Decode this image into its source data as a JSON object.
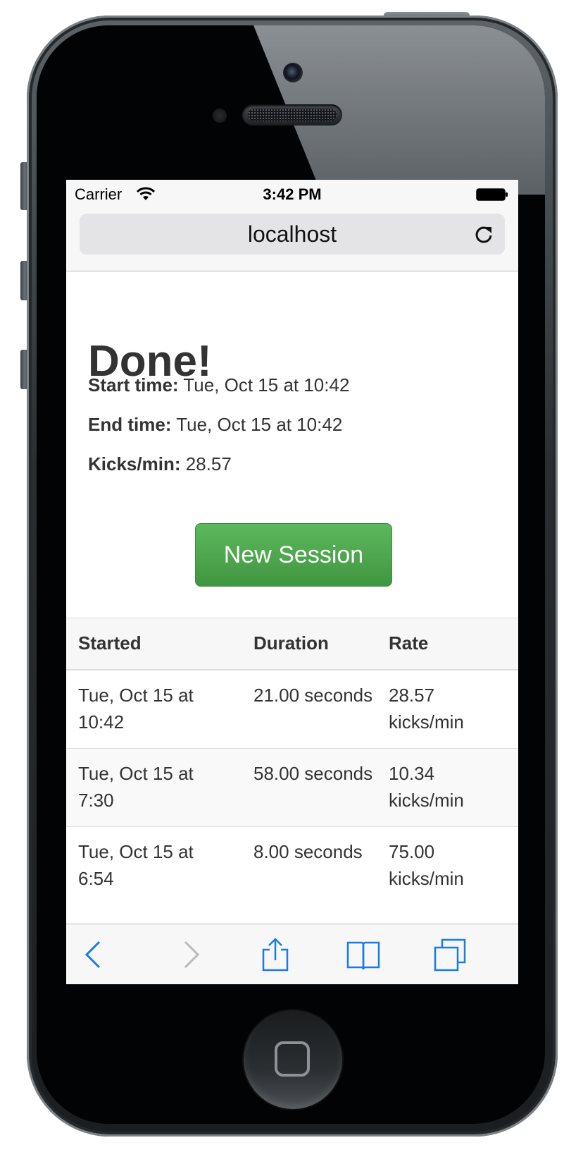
{
  "status_bar": {
    "carrier": "Carrier",
    "time": "3:42 PM"
  },
  "browser": {
    "url": "localhost"
  },
  "page": {
    "title": "Done!",
    "start_label": "Start time:",
    "start_value": "Tue, Oct 15 at 10:42",
    "end_label": "End time:",
    "end_value": "Tue, Oct 15 at 10:42",
    "rate_label": "Kicks/min:",
    "rate_value": "28.57",
    "new_session_label": "New Session"
  },
  "table": {
    "headers": [
      "Started",
      "Duration",
      "Rate"
    ],
    "rows": [
      {
        "started": "Tue, Oct 15 at 10:42",
        "duration": "21.00 seconds",
        "rate": "28.57 kicks/min"
      },
      {
        "started": "Tue, Oct 15 at 7:30",
        "duration": "58.00 seconds",
        "rate": "10.34 kicks/min"
      },
      {
        "started": "Tue, Oct 15 at 6:54",
        "duration": "8.00 seconds",
        "rate": "75.00 kicks/min"
      }
    ]
  },
  "toolbar": {
    "icons": [
      "back-icon",
      "forward-icon",
      "share-icon",
      "bookmarks-icon",
      "tabs-icon"
    ]
  },
  "colors": {
    "accent": "#1a7ae6",
    "button_green": "#5cb85c"
  }
}
